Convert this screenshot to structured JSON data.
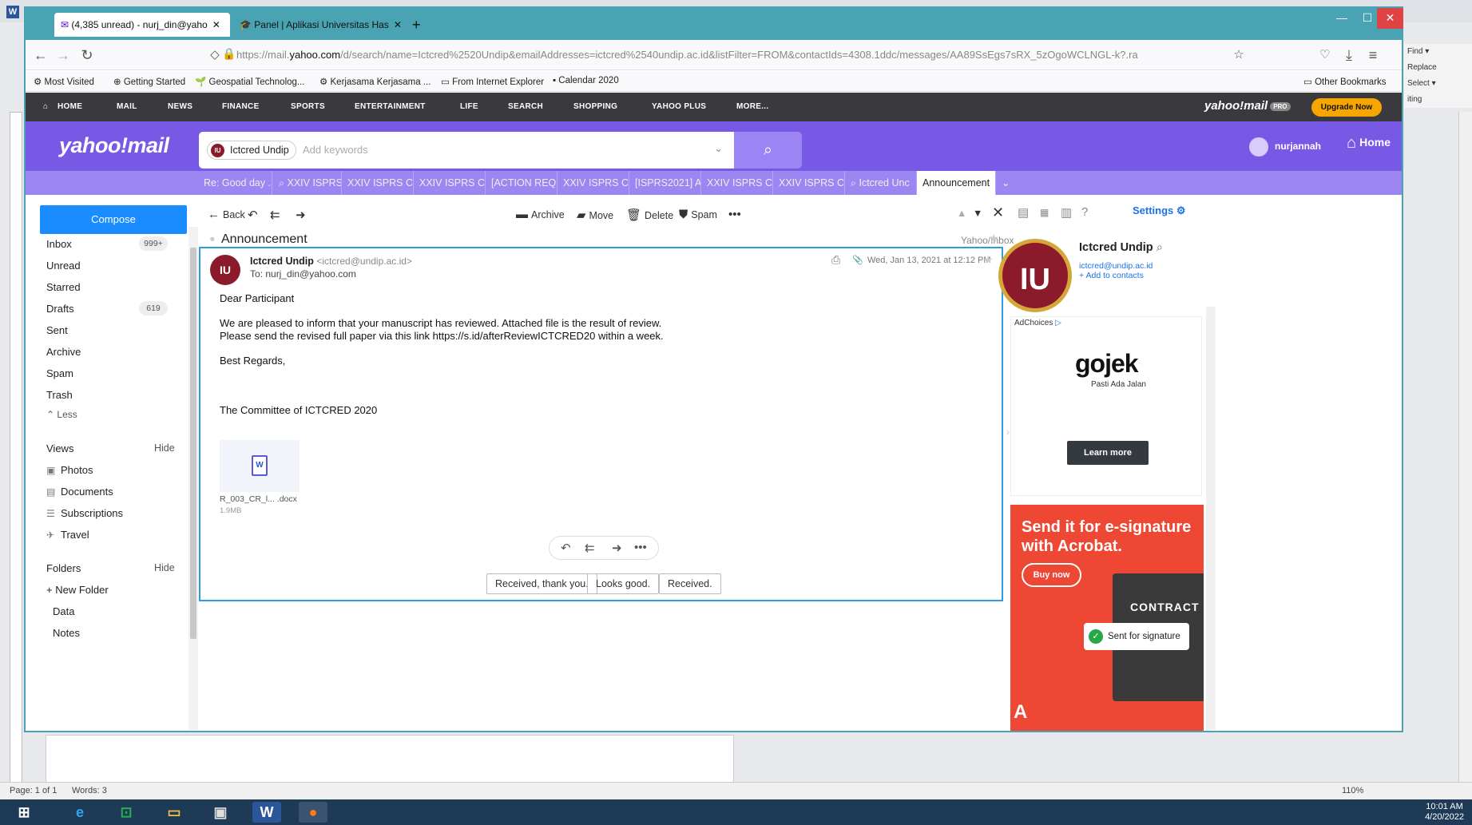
{
  "word": {
    "ribbon_right": [
      "Find ▾",
      "Replace",
      "Select ▾",
      "iting"
    ],
    "status": {
      "page": "Page: 1 of 1",
      "words": "Words: 3",
      "zoom": "110%"
    }
  },
  "taskbar": {
    "time": "10:01 AM",
    "date": "4/20/2022"
  },
  "browser": {
    "tabs": [
      {
        "label": "(4,385 unread) - nurj_din@yaho",
        "active": true
      },
      {
        "label": "Panel | Aplikasi Universitas Has",
        "active": false
      }
    ],
    "url_prefix": "https://mail.",
    "url_domain": "yahoo.com",
    "url_rest": "/d/search/name=Ictcred%2520Undip&emailAddresses=ictcred%2540undip.ac.id&listFilter=FROM&contactIds=4308.1ddc/messages/AA89SsEgs7sRX_5zOgoWCLNGL-k?.ra",
    "bookmarks": [
      "Most Visited",
      "Getting Started",
      "Geospatial Technolog...",
      "Kerjasama Kerjasama ...",
      "From Internet Explorer",
      "Calendar 2020"
    ],
    "other_bookmarks": "Other Bookmarks"
  },
  "yahoo_nav": {
    "items": [
      "HOME",
      "MAIL",
      "NEWS",
      "FINANCE",
      "SPORTS",
      "ENTERTAINMENT",
      "LIFE",
      "SEARCH",
      "SHOPPING",
      "YAHOO PLUS",
      "MORE..."
    ],
    "logo": "yahoo!mail",
    "pro": "PRO",
    "upgrade": "Upgrade Now"
  },
  "header": {
    "logo": "yahoo!mail",
    "search_chip": "Ictcred Undip",
    "chip_avatar": "IU",
    "search_placeholder": "Add keywords",
    "username": "nurjannah",
    "home": "Home"
  },
  "mail_tabs": [
    "Re: Good day .",
    "XXIV ISPRS",
    "XXIV ISPRS Cor",
    "XXIV ISPRS Cor",
    "[ACTION REQU",
    "XXIV ISPRS Cor",
    "[ISPRS2021] Ab",
    "XXIV ISPRS Cor",
    "XXIV ISPRS Cor",
    "Ictcred Unc",
    "Announcement"
  ],
  "sidebar": {
    "compose": "Compose",
    "folders": [
      {
        "label": "Inbox",
        "count": "999+"
      },
      {
        "label": "Unread",
        "count": ""
      },
      {
        "label": "Starred",
        "count": ""
      },
      {
        "label": "Drafts",
        "count": "619"
      },
      {
        "label": "Sent",
        "count": ""
      },
      {
        "label": "Archive",
        "count": ""
      },
      {
        "label": "Spam",
        "count": ""
      },
      {
        "label": "Trash",
        "count": ""
      }
    ],
    "less": "Less",
    "views_title": "Views",
    "views_hide": "Hide",
    "views": [
      "Photos",
      "Documents",
      "Subscriptions",
      "Travel"
    ],
    "folders_title": "Folders",
    "folders_hide": "Hide",
    "new_folder": "New Folder",
    "custom_folders": [
      "Data",
      "Notes"
    ]
  },
  "toolbar": {
    "back": "Back",
    "archive": "Archive",
    "move": "Move",
    "delete": "Delete",
    "spam": "Spam"
  },
  "message": {
    "subject": "Announcement",
    "folder": "Yahoo/Inbox",
    "sender_avatar": "IU",
    "from_name": "Ictcred Undip",
    "from_email": "<ictcred@undip.ac.id>",
    "to": "To: nurj_din@yahoo.com",
    "date": "Wed, Jan 13, 2021 at 12:12 PM",
    "greeting": "Dear Participant",
    "line1": "We are pleased to inform that your manuscript has reviewed. Attached file is the result of review.",
    "line2": "Please send the revised full paper via this link https://s.id/afterReviewICTCRED20 within a week.",
    "regards": "Best Regards,",
    "signature": "The Committee of ICTCRED 2020",
    "attachment_name": "R_003_CR_l... .docx",
    "attachment_size": "1.9MB",
    "quick_replies": [
      "Received, thank you.",
      "Looks good.",
      "Received."
    ]
  },
  "right_panel": {
    "settings": "Settings",
    "contact_name": "Ictcred Undip",
    "contact_avatar": "IU",
    "contact_email": "ictcred@undip.ac.id",
    "add_contacts": "+ Add to contacts",
    "ad1": {
      "adchoices": "AdChoices",
      "brand": "gojek",
      "tagline": "Pasti Ada Jalan",
      "cta": "Learn more"
    },
    "ad2": {
      "headline": "Send it for e-signature with Acrobat.",
      "cta": "Buy now",
      "contract": "CONTRACT",
      "sent": "Sent for signature"
    }
  }
}
